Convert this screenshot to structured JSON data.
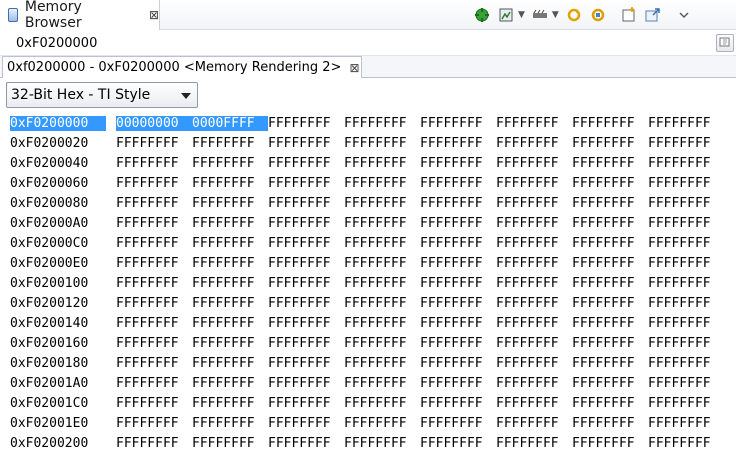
{
  "view": {
    "title": "Memory Browser",
    "close_glyph": "⊠"
  },
  "toolbar": {
    "icons": [
      "connect-icon",
      "memory-save-icon",
      "memory-load-icon",
      "refresh-sync-icon",
      "refresh-sync-alt-icon",
      "new-tab-icon",
      "open-view-icon",
      "view-menu-icon"
    ]
  },
  "address_bar": {
    "value": "0xF0200000",
    "button_icon": "go-icon"
  },
  "rendering_tab": {
    "label": "0xf0200000 - 0xF0200000 <Memory Rendering 2>",
    "close_glyph": "⊠"
  },
  "format": {
    "selected": "32-Bit Hex - TI Style"
  },
  "memory": {
    "rows": [
      {
        "address": "0xF0200000",
        "values": [
          "00000000",
          "0000FFFF",
          "FFFFFFFF",
          "FFFFFFFF",
          "FFFFFFFF",
          "FFFFFFFF",
          "FFFFFFFF",
          "FFFFFFFF"
        ]
      },
      {
        "address": "0xF0200020",
        "values": [
          "FFFFFFFF",
          "FFFFFFFF",
          "FFFFFFFF",
          "FFFFFFFF",
          "FFFFFFFF",
          "FFFFFFFF",
          "FFFFFFFF",
          "FFFFFFFF"
        ]
      },
      {
        "address": "0xF0200040",
        "values": [
          "FFFFFFFF",
          "FFFFFFFF",
          "FFFFFFFF",
          "FFFFFFFF",
          "FFFFFFFF",
          "FFFFFFFF",
          "FFFFFFFF",
          "FFFFFFFF"
        ]
      },
      {
        "address": "0xF0200060",
        "values": [
          "FFFFFFFF",
          "FFFFFFFF",
          "FFFFFFFF",
          "FFFFFFFF",
          "FFFFFFFF",
          "FFFFFFFF",
          "FFFFFFFF",
          "FFFFFFFF"
        ]
      },
      {
        "address": "0xF0200080",
        "values": [
          "FFFFFFFF",
          "FFFFFFFF",
          "FFFFFFFF",
          "FFFFFFFF",
          "FFFFFFFF",
          "FFFFFFFF",
          "FFFFFFFF",
          "FFFFFFFF"
        ]
      },
      {
        "address": "0xF02000A0",
        "values": [
          "FFFFFFFF",
          "FFFFFFFF",
          "FFFFFFFF",
          "FFFFFFFF",
          "FFFFFFFF",
          "FFFFFFFF",
          "FFFFFFFF",
          "FFFFFFFF"
        ]
      },
      {
        "address": "0xF02000C0",
        "values": [
          "FFFFFFFF",
          "FFFFFFFF",
          "FFFFFFFF",
          "FFFFFFFF",
          "FFFFFFFF",
          "FFFFFFFF",
          "FFFFFFFF",
          "FFFFFFFF"
        ]
      },
      {
        "address": "0xF02000E0",
        "values": [
          "FFFFFFFF",
          "FFFFFFFF",
          "FFFFFFFF",
          "FFFFFFFF",
          "FFFFFFFF",
          "FFFFFFFF",
          "FFFFFFFF",
          "FFFFFFFF"
        ]
      },
      {
        "address": "0xF0200100",
        "values": [
          "FFFFFFFF",
          "FFFFFFFF",
          "FFFFFFFF",
          "FFFFFFFF",
          "FFFFFFFF",
          "FFFFFFFF",
          "FFFFFFFF",
          "FFFFFFFF"
        ]
      },
      {
        "address": "0xF0200120",
        "values": [
          "FFFFFFFF",
          "FFFFFFFF",
          "FFFFFFFF",
          "FFFFFFFF",
          "FFFFFFFF",
          "FFFFFFFF",
          "FFFFFFFF",
          "FFFFFFFF"
        ]
      },
      {
        "address": "0xF0200140",
        "values": [
          "FFFFFFFF",
          "FFFFFFFF",
          "FFFFFFFF",
          "FFFFFFFF",
          "FFFFFFFF",
          "FFFFFFFF",
          "FFFFFFFF",
          "FFFFFFFF"
        ]
      },
      {
        "address": "0xF0200160",
        "values": [
          "FFFFFFFF",
          "FFFFFFFF",
          "FFFFFFFF",
          "FFFFFFFF",
          "FFFFFFFF",
          "FFFFFFFF",
          "FFFFFFFF",
          "FFFFFFFF"
        ]
      },
      {
        "address": "0xF0200180",
        "values": [
          "FFFFFFFF",
          "FFFFFFFF",
          "FFFFFFFF",
          "FFFFFFFF",
          "FFFFFFFF",
          "FFFFFFFF",
          "FFFFFFFF",
          "FFFFFFFF"
        ]
      },
      {
        "address": "0xF02001A0",
        "values": [
          "FFFFFFFF",
          "FFFFFFFF",
          "FFFFFFFF",
          "FFFFFFFF",
          "FFFFFFFF",
          "FFFFFFFF",
          "FFFFFFFF",
          "FFFFFFFF"
        ]
      },
      {
        "address": "0xF02001C0",
        "values": [
          "FFFFFFFF",
          "FFFFFFFF",
          "FFFFFFFF",
          "FFFFFFFF",
          "FFFFFFFF",
          "FFFFFFFF",
          "FFFFFFFF",
          "FFFFFFFF"
        ]
      },
      {
        "address": "0xF02001E0",
        "values": [
          "FFFFFFFF",
          "FFFFFFFF",
          "FFFFFFFF",
          "FFFFFFFF",
          "FFFFFFFF",
          "FFFFFFFF",
          "FFFFFFFF",
          "FFFFFFFF"
        ]
      },
      {
        "address": "0xF0200200",
        "values": [
          "FFFFFFFF",
          "FFFFFFFF",
          "FFFFFFFF",
          "FFFFFFFF",
          "FFFFFFFF",
          "FFFFFFFF",
          "FFFFFFFF",
          "FFFFFFFF"
        ]
      }
    ],
    "selected_address_row": 0,
    "selected_cells": [
      0,
      1
    ],
    "selection_color": "#3399ff"
  }
}
